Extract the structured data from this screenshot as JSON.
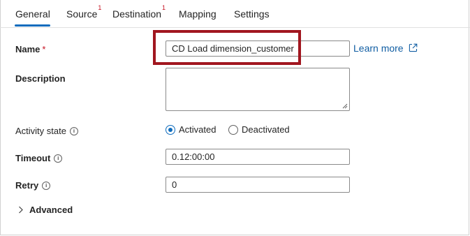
{
  "tabs": [
    {
      "label": "General",
      "badge": ""
    },
    {
      "label": "Source",
      "badge": "1"
    },
    {
      "label": "Destination",
      "badge": "1"
    },
    {
      "label": "Mapping",
      "badge": ""
    },
    {
      "label": "Settings",
      "badge": ""
    }
  ],
  "active_tab": "General",
  "accent_color": "#0f6cbd",
  "highlight_color": "#a1161f",
  "form": {
    "name": {
      "label": "Name",
      "required_mark": "*",
      "value": "CD Load dimension_customer"
    },
    "learn_more": "Learn more",
    "description": {
      "label": "Description",
      "value": ""
    },
    "activity_state": {
      "label": "Activity state",
      "options": [
        "Activated",
        "Deactivated"
      ],
      "selected": "Activated"
    },
    "timeout": {
      "label": "Timeout",
      "value": "0.12:00:00"
    },
    "retry": {
      "label": "Retry",
      "value": "0"
    },
    "advanced": {
      "label": "Advanced"
    }
  }
}
